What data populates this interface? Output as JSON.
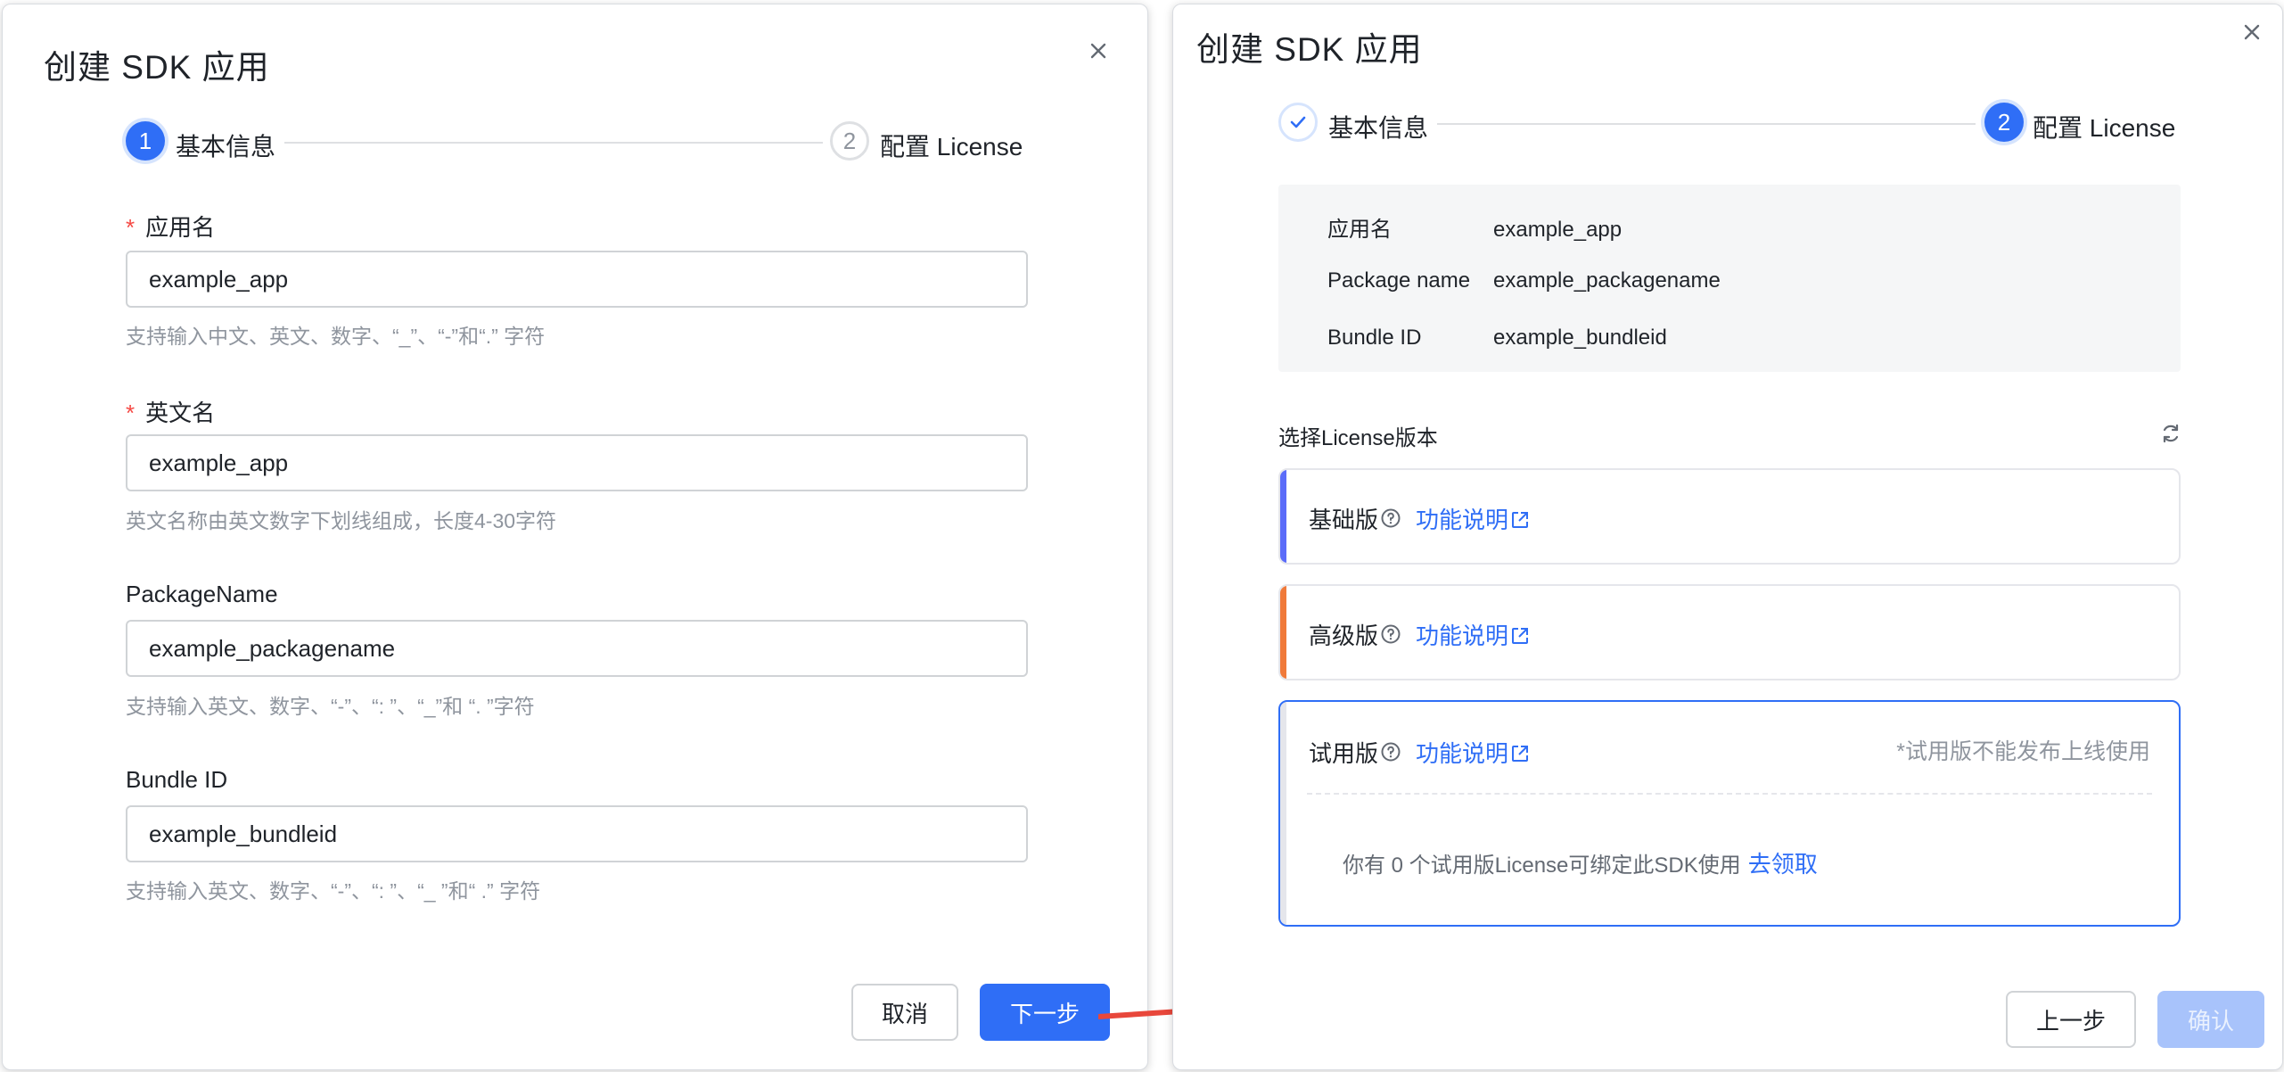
{
  "dialog_left": {
    "title": "创建 SDK 应用",
    "steps": [
      {
        "number": "1",
        "label": "基本信息",
        "state": "active"
      },
      {
        "number": "2",
        "label": "配置 License",
        "state": "pending"
      }
    ],
    "fields": [
      {
        "label": "应用名",
        "required": true,
        "value": "example_app",
        "hint": "支持输入中文、英文、数字、“_”、“-”和“.” 字符"
      },
      {
        "label": "英文名",
        "required": true,
        "value": "example_app",
        "hint": "英文名称由英文数字下划线组成，长度4-30字符"
      },
      {
        "label": "PackageName",
        "required": false,
        "value": "example_packagename",
        "hint": "支持输入英文、数字、“-”、“: ”、“_”和 “. ”字符"
      },
      {
        "label": "Bundle ID",
        "required": false,
        "value": "example_bundleid",
        "hint": "支持输入英文、数字、“-”、“: ”、“_ ”和“ .” 字符"
      }
    ],
    "cancel_label": "取消",
    "next_label": "下一步"
  },
  "dialog_right": {
    "title": "创建 SDK 应用",
    "steps": [
      {
        "label": "基本信息",
        "state": "done"
      },
      {
        "number": "2",
        "label": "配置 License",
        "state": "active"
      }
    ],
    "summary": [
      {
        "key": "应用名",
        "value": "example_app"
      },
      {
        "key": "Package name",
        "value": "example_packagename"
      },
      {
        "key": "Bundle ID",
        "value": "example_bundleid"
      }
    ],
    "section_title": "选择License版本",
    "licenses": [
      {
        "name": "基础版",
        "link": "功能说明",
        "accent": "#5b6cf9"
      },
      {
        "name": "高级版",
        "link": "功能说明",
        "accent": "#f07a3a"
      },
      {
        "name": "试用版",
        "link": "功能说明",
        "note": "*试用版不能发布上线使用",
        "count_text": "你有 0 个试用版License可绑定此SDK使用",
        "claim_label": "去领取",
        "selected": true
      }
    ],
    "prev_label": "上一步",
    "confirm_label": "确认"
  },
  "colors": {
    "primary": "#2f6ef6",
    "required": "#f54a45",
    "arrow": "#e8473b"
  }
}
